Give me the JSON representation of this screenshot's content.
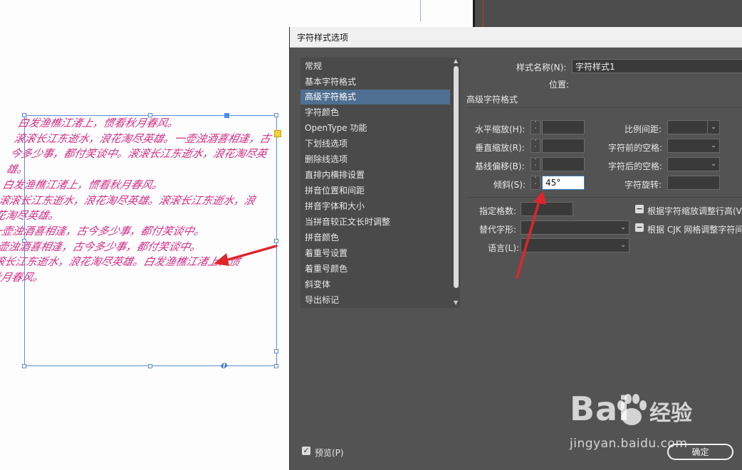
{
  "document": {
    "paragraphs": [
      "白发渔樵江渚上，惯看秋月春风。",
      "滚滚长江东逝水，浪花淘尽英雄。一壶浊酒喜相逢，古今多少事，都付笑谈中。滚滚长江东逝水，浪花淘尽英雄。",
      "白发渔樵江渚上，惯看秋月春风。",
      "滚滚长江东逝水，浪花淘尽英雄。滚滚长江东逝水，浪花淘尽英雄。",
      "一壶浊酒喜相逢，古今多少事，都付笑谈中。",
      "一壶浊酒喜相逢，古今多少事，都付笑谈中。",
      "滚滚长江东逝水，浪花淘尽英雄。白发渔樵江渚上，惯看秋月春风。"
    ],
    "frame_port_symbol": "o"
  },
  "dialog": {
    "title": "字符样式选项",
    "categories": [
      "常规",
      "基本字符格式",
      "高级字符格式",
      "字符颜色",
      "OpenType 功能",
      "下划线选项",
      "删除线选项",
      "直排内横排设置",
      "拼音位置和间距",
      "拼音字体和大小",
      "当拼音较正文长时调整",
      "拼音颜色",
      "着重号设置",
      "着重号颜色",
      "斜变体",
      "导出标记"
    ],
    "selected_category_index": 2,
    "style_name_label": "样式名称(N):",
    "style_name_value": "字符样式1",
    "location_label": "位置:",
    "section_title": "高级字符格式",
    "fields": {
      "horizontal_scale_label": "水平缩放(H):",
      "horizontal_scale_value": "",
      "vertical_scale_label": "垂直缩放(R):",
      "vertical_scale_value": "",
      "baseline_shift_label": "基线偏移(B):",
      "baseline_shift_value": "",
      "skew_label": "倾斜(S):",
      "skew_value": "45°",
      "proportional_spacing_label": "比例间距:",
      "proportional_spacing_value": "",
      "space_before_label": "字符前的空格:",
      "space_before_value": "",
      "space_after_label": "字符后的空格:",
      "space_after_value": "",
      "char_rotation_label": "字符旋转:",
      "char_rotation_value": "",
      "grid_count_label": "指定格数:",
      "grid_count_value": "",
      "alternate_glyph_label": "替代字形:",
      "alternate_glyph_value": "",
      "language_label": "语言(L):",
      "language_value": ""
    },
    "checkboxes": {
      "adjust_line_height_label": "根据字符缩放调整行高(V",
      "adjust_cjk_grid_label": "根据 CJK 网格调整字符间"
    },
    "preview_label": "预览(P)",
    "ok_label": "确定"
  },
  "watermark": {
    "brand_left": "Bai",
    "brand_right": "经验",
    "url": "jingyan.baidu.com"
  },
  "colors": {
    "dialog_bg": "#535353",
    "selected_category": "#4f6f92",
    "text_magenta": "#d0308a",
    "frame_blue": "#5b8bd6",
    "annotation_red": "#e0262b"
  }
}
